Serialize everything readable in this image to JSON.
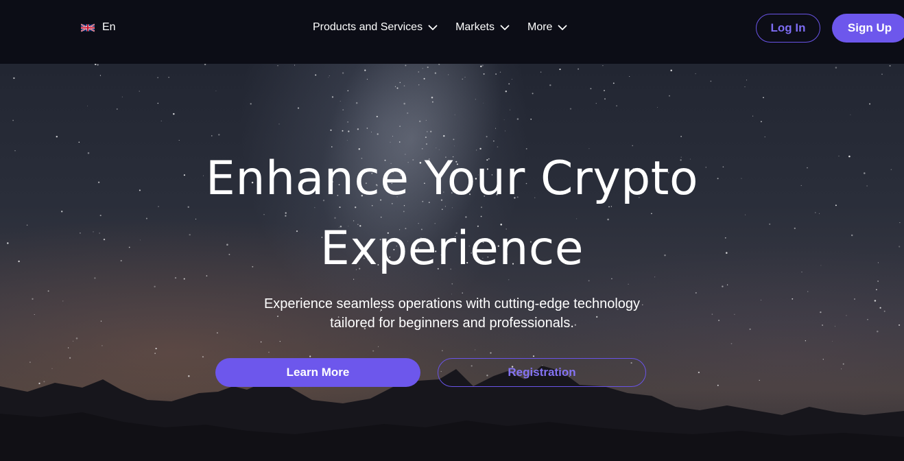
{
  "header": {
    "language": {
      "label": "En",
      "flag_icon": "uk-flag-icon"
    },
    "nav": [
      {
        "label": "Products and Services",
        "icon": "chevron-down-icon"
      },
      {
        "label": "Markets",
        "icon": "chevron-down-icon"
      },
      {
        "label": "More",
        "icon": "chevron-down-icon"
      }
    ],
    "login_label": "Log In",
    "signup_label": "Sign Up"
  },
  "hero": {
    "title_line1": "Enhance Your Crypto",
    "title_line2": "Experience",
    "subtitle_line1": "Experience seamless operations with cutting-edge technology",
    "subtitle_line2": "tailored for beginners and professionals.",
    "learn_more_label": "Learn More",
    "registration_label": "Registration"
  },
  "colors": {
    "accent": "#6d57ec",
    "background": "#0c0d16",
    "text": "#ffffff"
  }
}
